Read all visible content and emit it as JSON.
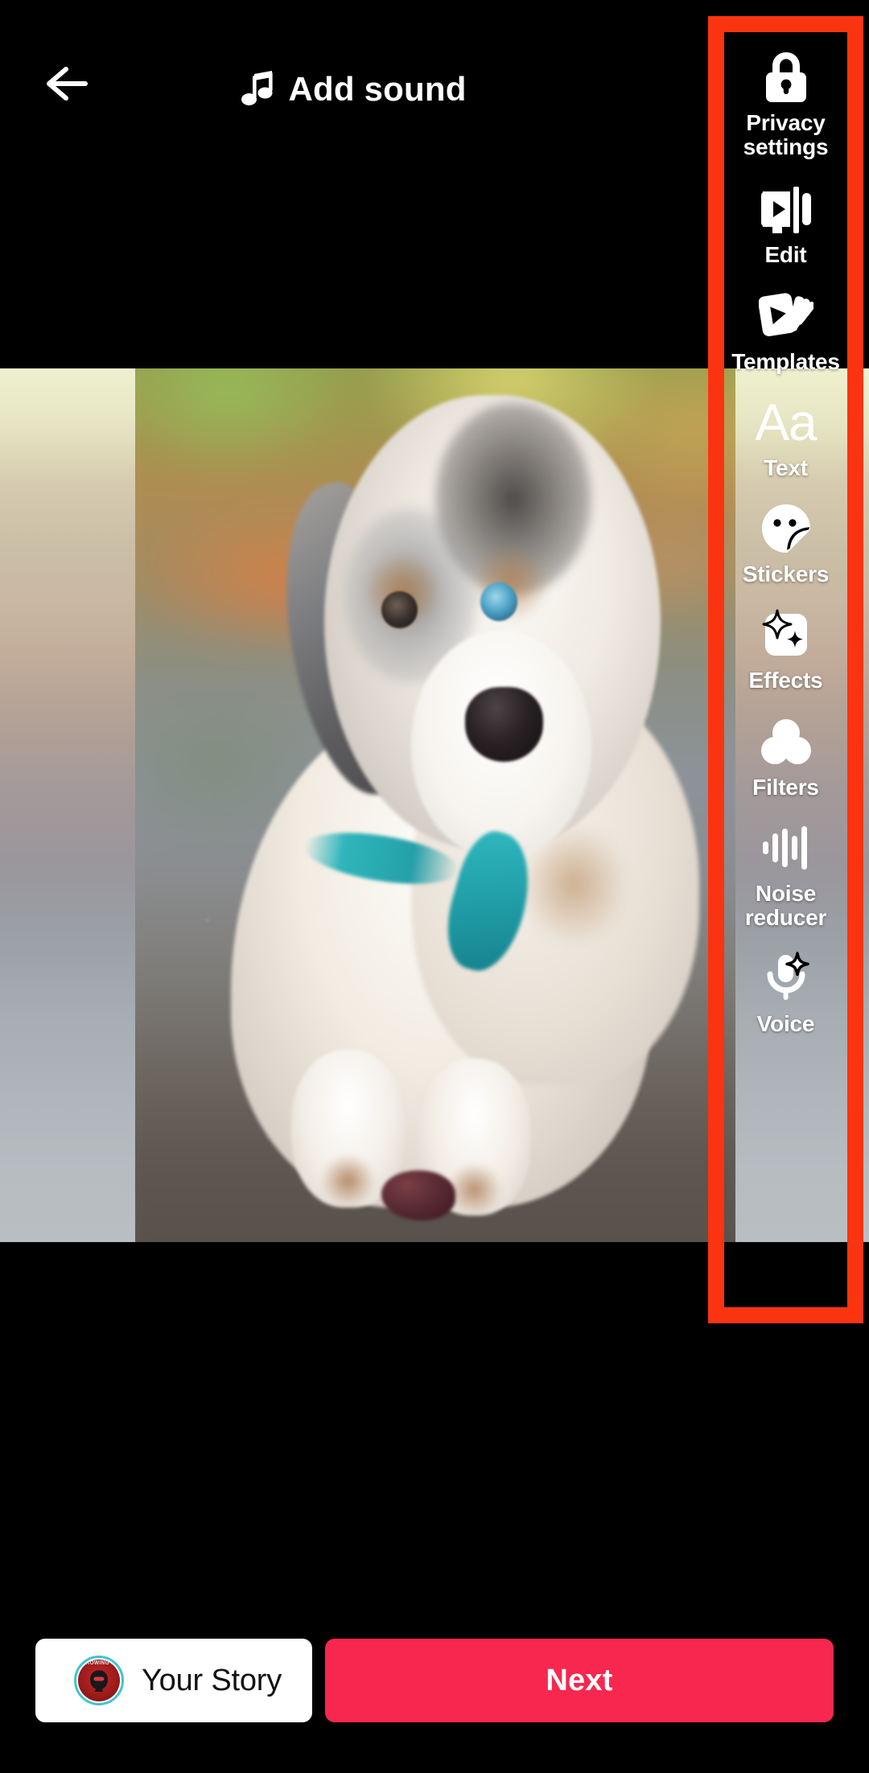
{
  "header": {
    "back_icon": "back-arrow-icon",
    "sound_icon": "music-note-icon",
    "sound_label": "Add sound"
  },
  "media": {
    "subject": "australian-shepherd-puppy-photo",
    "description": "Blue merle Australian Shepherd puppy with teal collar lying on a dirt path"
  },
  "tool_rail": {
    "highlight_color": "#FA3410",
    "items": [
      {
        "id": "privacy-settings",
        "icon": "lock-icon",
        "label": "Privacy\nsettings",
        "label_line1": "Privacy",
        "label_line2": "settings"
      },
      {
        "id": "edit",
        "icon": "video-edit-icon",
        "label": "Edit"
      },
      {
        "id": "templates",
        "icon": "template-cards-icon",
        "label": "Templates"
      },
      {
        "id": "text",
        "icon": "aa-text-icon",
        "label": "Text",
        "glyph": "Aa"
      },
      {
        "id": "stickers",
        "icon": "sticker-smiley-icon",
        "label": "Stickers"
      },
      {
        "id": "effects",
        "icon": "sparkles-icon",
        "label": "Effects"
      },
      {
        "id": "filters",
        "icon": "three-circles-icon",
        "label": "Filters"
      },
      {
        "id": "noise-reducer",
        "icon": "waveform-icon",
        "label": "Noise\nreducer",
        "label_line1": "Noise",
        "label_line2": "reducer"
      },
      {
        "id": "voice",
        "icon": "microphone-sparkle-icon",
        "label": "Voice"
      }
    ]
  },
  "bottom_bar": {
    "story": {
      "label": "Your Story",
      "avatar_name": "throwing-ninja-avatar",
      "avatar_text": "THROWING NINJA",
      "background": "#FFFFFF",
      "text_color": "#111111"
    },
    "next": {
      "label": "Next",
      "background": "#F8274F",
      "text_color": "#FFFFFF"
    }
  }
}
